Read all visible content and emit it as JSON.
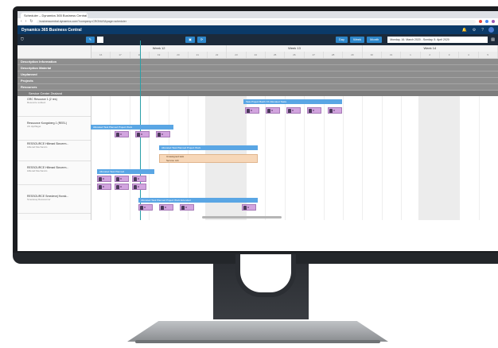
{
  "browser": {
    "tab_label": "Scheduler – Dynamics 365 Business Central",
    "tab_close": "×",
    "url": "businesscentral.dynamics.com/?company=CRONUS&page=scheduler",
    "back": "‹",
    "forward": "›",
    "reload": "↻"
  },
  "app": {
    "title": "Dynamics 365 Business Central",
    "icons": [
      "bell-icon",
      "gear-icon",
      "help-icon",
      "user-avatar"
    ]
  },
  "toolbar": {
    "filter_icon": "⛉",
    "btn_day": "Day",
    "btn_week": "Week",
    "btn_month": "Month",
    "date_range": "Monday, 16. March 2020 - Sunday, 5. April 2020"
  },
  "timeline": {
    "weeks": [
      "Week 12",
      "Week 13",
      "Week 14"
    ],
    "days": [
      "16",
      "17",
      "18",
      "19",
      "20",
      "21",
      "22",
      "23",
      "24",
      "25",
      "26",
      "27",
      "28",
      "29",
      "30",
      "31",
      "1",
      "2",
      "3",
      "4",
      "5"
    ]
  },
  "groups": [
    "Description Information",
    "Description Material",
    "Unplanned",
    "Projects",
    "Resources"
  ],
  "subgroup": "Service Center Zealand",
  "resources": [
    {
      "name": "GRC Resource 1 (2 res)",
      "sub": "Resource subtext"
    },
    {
      "name": "Ressource Kongsberg 1 (REEL)",
      "sub": "AS Hjulflaget"
    },
    {
      "name": "RESSOURCE Hillerød Skruerm...",
      "sub": "Hillerød Mechanics"
    },
    {
      "name": "RESSOURCE Hillerød Skruerm...",
      "sub": "Hillerød Mechanics"
    },
    {
      "name": "RESSOURCE Smedevej Hovsk...",
      "sub": "Smedevej Ressourcer"
    }
  ],
  "bars": [
    {
      "label": "Task Project Batch XX Allocated Tasks"
    },
    {
      "label": "Allocated Task Planned Project Work"
    },
    {
      "label": "Allocated Task Planned Project Work"
    },
    {
      "label": "Allocated Task Planned"
    },
    {
      "label": "Allocated Task Planned Project Work Extended"
    }
  ],
  "orange_task": {
    "label": "Unassigned task",
    "sub": "Service Job"
  },
  "chip_label": "R"
}
